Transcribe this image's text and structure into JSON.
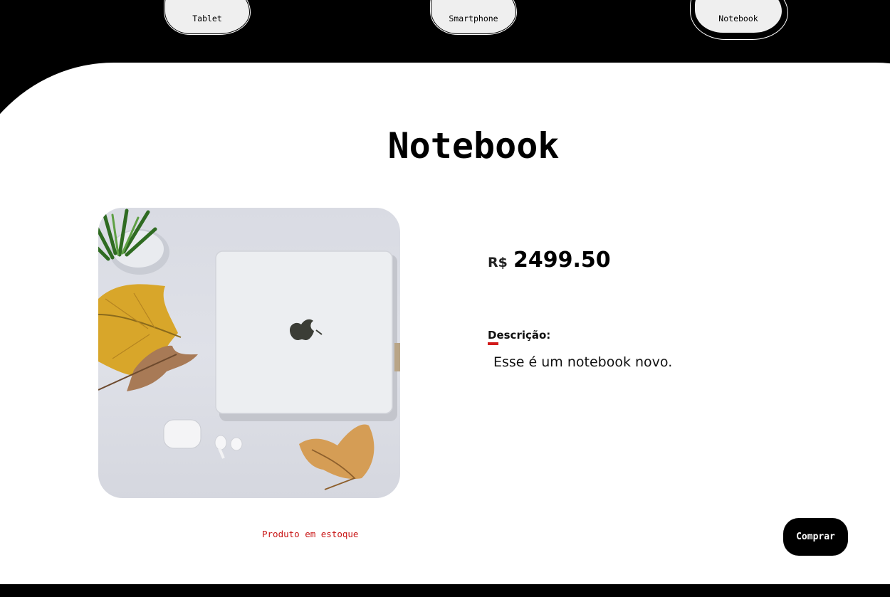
{
  "nav": {
    "items": [
      {
        "label": "Tablet"
      },
      {
        "label": "Smartphone"
      },
      {
        "label": "Notebook",
        "active": true
      }
    ]
  },
  "product": {
    "title": "Notebook",
    "currency": "R$",
    "price": "2499.50",
    "description_label": "Descrição:",
    "description": "Esse é um notebook novo.",
    "stock_status": "Produto em estoque",
    "buy_label": "Comprar",
    "image_icon": "laptop-photo"
  },
  "colors": {
    "accent_red": "#d11a1a",
    "stock_red": "#c81414",
    "background": "#000000",
    "card": "#ffffff"
  }
}
